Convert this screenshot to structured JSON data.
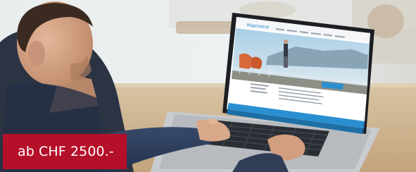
{
  "price_badge": {
    "label": "ab CHF 2500.-"
  },
  "colors": {
    "badge": "#b5102a",
    "site_accent": "#2a8fd0",
    "wall": "#eef0f0",
    "desk": "#cdb592"
  },
  "laptop_screen": {
    "site_logo": "Wagnisdesk"
  }
}
